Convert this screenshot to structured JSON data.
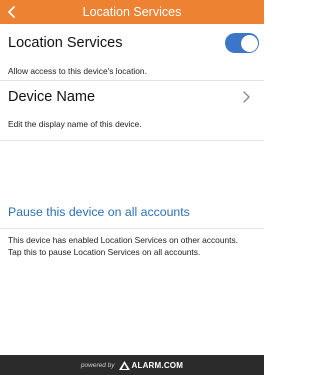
{
  "header": {
    "title": "Location Services",
    "back_icon": "chevron-left-icon"
  },
  "location_services": {
    "label": "Location Services",
    "enabled": true,
    "description": "Allow access to this device's location.",
    "toggle_color": "#3b76c9"
  },
  "device_name": {
    "label": "Device Name",
    "description": "Edit the display name of this device.",
    "icon": "chevron-right-icon"
  },
  "pause": {
    "link": "Pause this device on all accounts",
    "description_line1": "This device has enabled Location Services on other accounts.",
    "description_line2": "Tap this to pause Location Services on all accounts.",
    "link_color": "#2b6fb6"
  },
  "footer": {
    "powered_by": "powered by",
    "brand": "ALARM.COM"
  },
  "colors": {
    "header": "#ee8233",
    "footer": "#2b2b2b"
  }
}
